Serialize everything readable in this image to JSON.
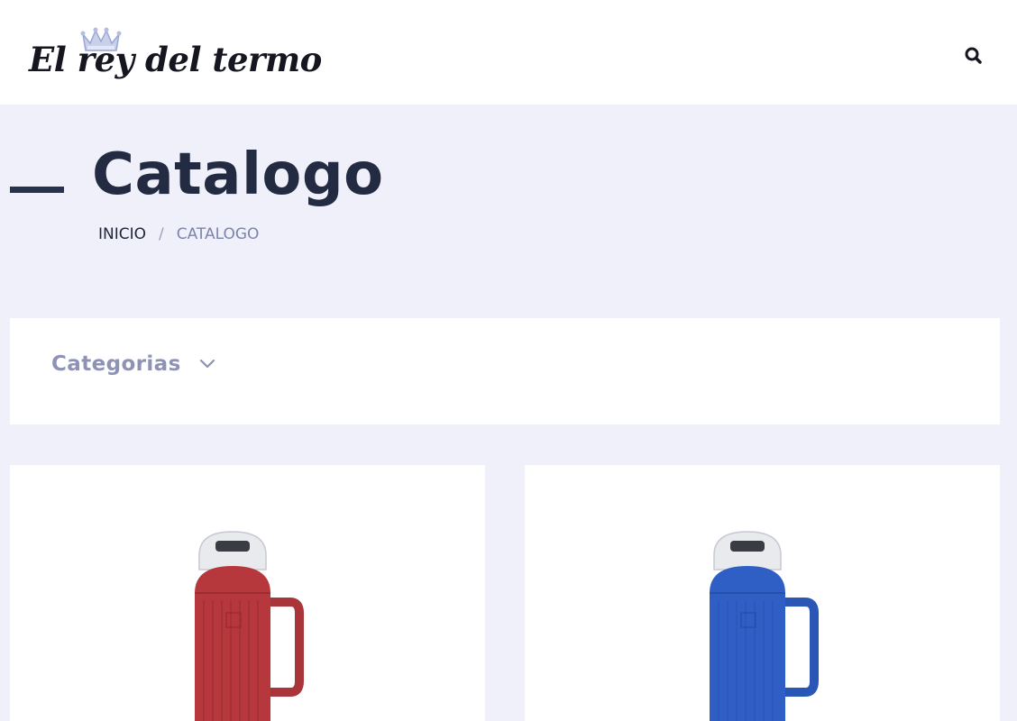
{
  "header": {
    "logo_text": "El rey del termo",
    "logo_icon": "crown-icon",
    "search_icon": "search-icon"
  },
  "page": {
    "title": "Catalogo"
  },
  "breadcrumb": {
    "home": "INICIO",
    "separator": "/",
    "current": "CATALOGO"
  },
  "filter": {
    "categories_label": "Categorias",
    "chevron_icon": "chevron-down-icon"
  },
  "products": [
    {
      "name": "red-thermos",
      "color": "#b7383c"
    },
    {
      "name": "blue-thermos",
      "color": "#2f5fc4"
    }
  ],
  "colors": {
    "page_bg": "#eff0fa",
    "title": "#232b42",
    "muted": "#8e93b6"
  }
}
